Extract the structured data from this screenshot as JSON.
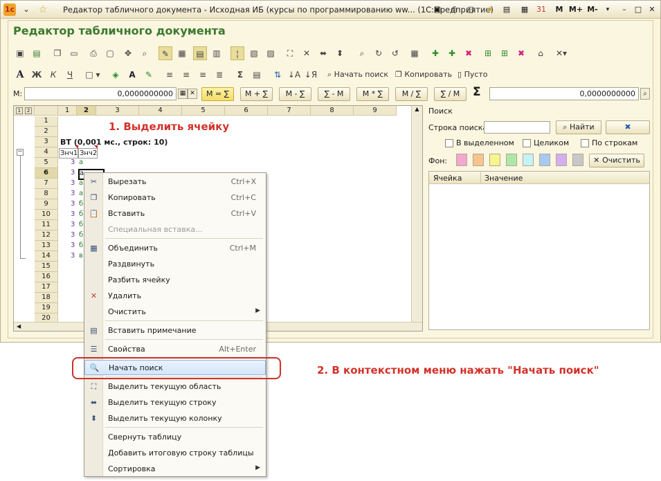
{
  "window": {
    "title": "Редактор табличного документа - Исходная ИБ (курсы по программированию ww...  (1С:Предприятие)",
    "caption": "Редактор табличного документа",
    "title_icons": [
      "1c-logo-icon",
      "dropdown-icon",
      "star-icon"
    ],
    "title_right_buttons": [
      "M",
      "M+",
      "M-"
    ]
  },
  "format_toolbar": {
    "search_label": "Начать поиск",
    "copy_label": "Копировать",
    "empty_label": "Пусто"
  },
  "memory_row": {
    "label": "M:",
    "left_value": "0,0000000000",
    "right_value": "0,0000000000",
    "buttons": [
      "M = ∑",
      "M + ∑",
      "M - ∑",
      "∑ - M",
      "M * ∑",
      "M / ∑",
      "∑ / M"
    ]
  },
  "grid": {
    "columns": [
      "1",
      "2",
      "3",
      "4",
      "5",
      "6",
      "7",
      "8",
      "9"
    ],
    "rows": [
      "1",
      "2",
      "3",
      "4",
      "5",
      "6",
      "7",
      "8",
      "9",
      "10",
      "11",
      "12",
      "13",
      "14",
      "15",
      "16",
      "17",
      "18",
      "19",
      "20"
    ],
    "vt_header": "ВТ (0,001 мс., строк: 10)",
    "col_header_1": "Знч1",
    "col_header_2": "Знч2",
    "data_rows": [
      {
        "n": "3",
        "v": "а"
      },
      {
        "n": "3",
        "v": "а"
      },
      {
        "n": "3",
        "v": "а"
      },
      {
        "n": "3",
        "v": "а"
      },
      {
        "n": "3",
        "v": "б"
      },
      {
        "n": "3",
        "v": "б"
      },
      {
        "n": "3",
        "v": "б"
      },
      {
        "n": "3",
        "v": "б"
      },
      {
        "n": "3",
        "v": "б"
      },
      {
        "n": "3",
        "v": "в"
      }
    ]
  },
  "search_panel": {
    "title": "Поиск",
    "search_label": "Строка поиска:",
    "find_button": "Найти",
    "clear_x": "✖",
    "opt_in_selection": "В выделенном",
    "opt_whole": "Целиком",
    "opt_by_rows": "По строкам",
    "bg_label": "Фон:",
    "clear_button": "Очистить",
    "col_cell": "Ячейка",
    "col_value": "Значение",
    "swatches": [
      "#f3a8cf",
      "#f6c48d",
      "#f7f48d",
      "#aee8a8",
      "#c5f3f5",
      "#a9c9f5",
      "#d5aef0",
      "#c8c8c8"
    ]
  },
  "context_menu": {
    "items": [
      {
        "label": "Вырезать",
        "shortcut": "Ctrl+X",
        "icon": "scissors-icon",
        "glyph": "✂"
      },
      {
        "label": "Копировать",
        "shortcut": "Ctrl+C",
        "icon": "copy-icon",
        "glyph": "❐"
      },
      {
        "label": "Вставить",
        "shortcut": "Ctrl+V",
        "icon": "paste-icon",
        "glyph": "📋"
      },
      {
        "label": "Специальная вставка...",
        "shortcut": "",
        "icon": "",
        "glyph": ""
      },
      {
        "label": "Объединить",
        "shortcut": "Ctrl+M",
        "icon": "merge-icon",
        "glyph": "▦"
      },
      {
        "label": "Раздвинуть",
        "shortcut": "",
        "icon": "",
        "glyph": ""
      },
      {
        "label": "Разбить ячейку",
        "shortcut": "",
        "icon": "",
        "glyph": ""
      },
      {
        "label": "Удалить",
        "shortcut": "",
        "icon": "delete-icon",
        "glyph": "✕"
      },
      {
        "label": "Очистить",
        "shortcut": "",
        "icon": "",
        "glyph": ""
      },
      {
        "label": "Вставить примечание",
        "shortcut": "",
        "icon": "note-icon",
        "glyph": "▤"
      },
      {
        "label": "Свойства",
        "shortcut": "Alt+Enter",
        "icon": "properties-icon",
        "glyph": "☰"
      },
      {
        "label": "Начать поиск",
        "shortcut": "",
        "icon": "search-icon",
        "glyph": "🔍"
      },
      {
        "label": "Выделить текущую область",
        "shortcut": "",
        "icon": "select-area-icon",
        "glyph": "⛶"
      },
      {
        "label": "Выделить текущую строку",
        "shortcut": "",
        "icon": "select-row-icon",
        "glyph": "⬌"
      },
      {
        "label": "Выделить текущую колонку",
        "shortcut": "",
        "icon": "select-column-icon",
        "glyph": "⬍"
      },
      {
        "label": "Свернуть таблицу",
        "shortcut": "",
        "icon": "",
        "glyph": ""
      },
      {
        "label": "Добавить итоговую строку таблицы",
        "shortcut": "",
        "icon": "",
        "glyph": ""
      },
      {
        "label": "Сортировка",
        "shortcut": "",
        "icon": "",
        "glyph": ""
      }
    ]
  },
  "annotations": {
    "step1": "1. Выделить ячейку",
    "step2": "2. В контекстном меню нажать \"Начать поиск\""
  },
  "colors": {
    "caption": "#3a7a2e",
    "annotation": "#d3322a",
    "highlight_border": "#c8312a"
  }
}
